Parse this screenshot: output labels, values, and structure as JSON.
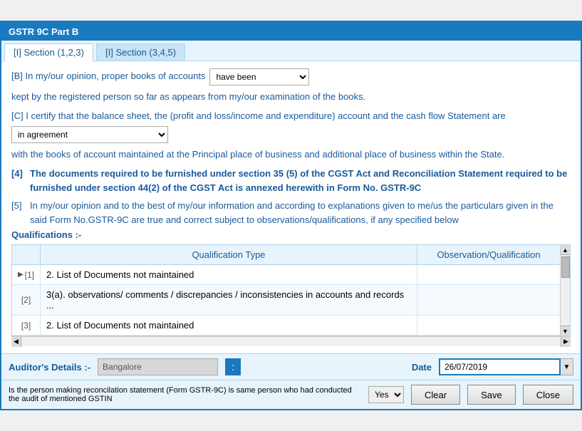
{
  "window": {
    "title": "GSTR 9C Part B"
  },
  "tabs": [
    {
      "id": "tab1",
      "label": "[I] Section (1,2,3)",
      "active": true
    },
    {
      "id": "tab2",
      "label": "[I] Section (3,4,5)",
      "active": false
    }
  ],
  "section_b": {
    "prefix": "[B] In my/our opinion, proper books of accounts",
    "dropdown_value": "have been",
    "suffix": "kept by the registered person so far as appears from my/our examination of the books."
  },
  "section_c": {
    "prefix": "[C] I certify that the balance sheet, the (profit and loss/income and expenditure) account and the cash flow Statement are",
    "dropdown_value": "in agreement",
    "suffix": "with the books of account maintained at the Principal place of business and additional place of business within the State."
  },
  "section_4": {
    "number": "[4]",
    "text": "The documents required to be furnished under section 35 (5) of the CGST Act and Reconciliation Statement required to be furnished under section 44(2) of the CGST Act is annexed herewith in Form No. GSTR-9C"
  },
  "section_5": {
    "number": "[5]",
    "text": "In my/our opinion and to the best of my/our information and according to explanations given to me/us the particulars given in the said Form No.GSTR-9C are true and correct subject to  observations/qualifications, if any specified below"
  },
  "qualifications_label": "Qualifications :-",
  "table": {
    "col_index_header": "",
    "col_qt_header": "Qualification Type",
    "col_oq_header": "Observation/Qualification",
    "rows": [
      {
        "index": "[1]",
        "has_arrow": true,
        "qt": "2. List of Documents not maintained",
        "oq": ""
      },
      {
        "index": "[2]",
        "has_arrow": false,
        "qt": "3(a). observations/ comments / discrepancies / inconsistencies in accounts and records ...",
        "oq": ""
      },
      {
        "index": "[3]",
        "has_arrow": false,
        "qt": "2. List of Documents not maintained",
        "oq": ""
      }
    ]
  },
  "auditor": {
    "label": "Auditor's Details :-",
    "input_value": "Bangalore",
    "dots_btn": ":",
    "date_label": "Date",
    "date_value": "26/07/2019"
  },
  "footer": {
    "question": "Is the person making reconcilation statement (Form GSTR-9C) is same person who had conducted the audit of mentioned GSTIN",
    "yes_option": "Yes",
    "clear_btn": "Clear",
    "save_btn": "Save",
    "close_btn": "Close"
  }
}
